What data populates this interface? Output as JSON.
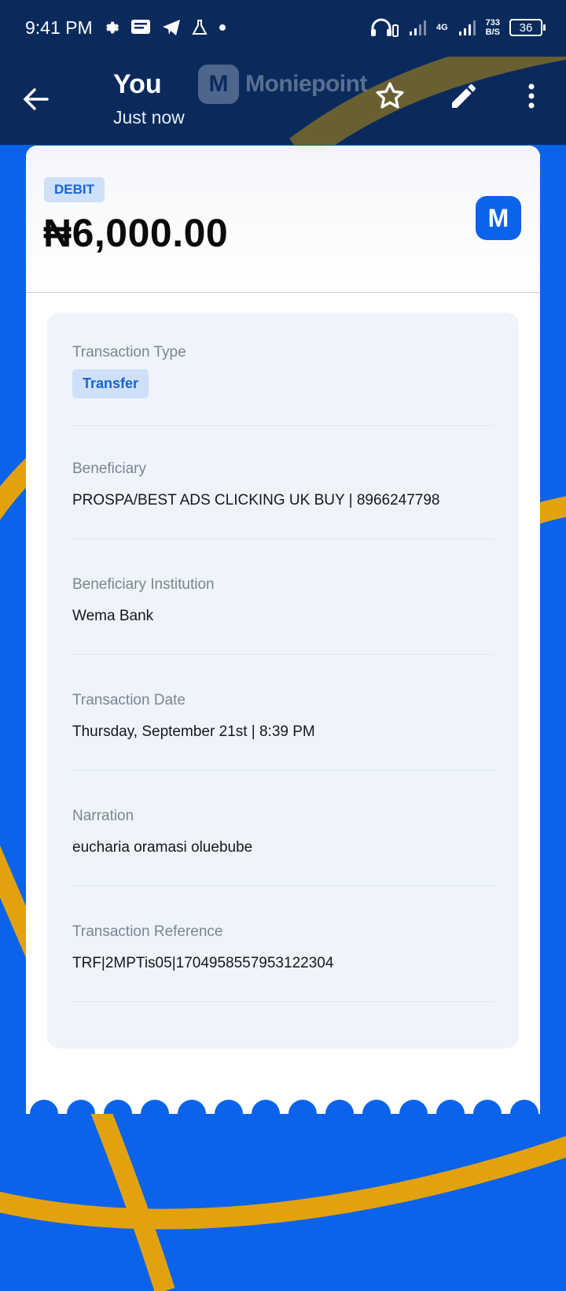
{
  "status_bar": {
    "time": "9:41 PM",
    "network": "4G",
    "speed_value": "733",
    "speed_unit": "B/S",
    "battery": "36"
  },
  "header": {
    "title": "You",
    "subtitle": "Just now",
    "brand_initial": "M",
    "brand_name": "Moniepoint"
  },
  "receipt": {
    "type_badge": "DEBIT",
    "amount": "₦6,000.00",
    "logo_initial": "M",
    "fields": [
      {
        "label": "Transaction Type",
        "value": "Transfer"
      },
      {
        "label": "Beneficiary",
        "value": "PROSPA/BEST ADS CLICKING UK BUY | 8966247798"
      },
      {
        "label": "Beneficiary Institution",
        "value": "Wema Bank"
      },
      {
        "label": "Transaction Date",
        "value": "Thursday, September 21st | 8:39 PM"
      },
      {
        "label": "Narration",
        "value": "eucharia oramasi oluebube"
      },
      {
        "label": "Transaction Reference",
        "value": "TRF|2MPTis05|1704958557953122304"
      }
    ]
  },
  "colors": {
    "header_bg": "#0b2a5c",
    "background_blue": "#0a63ea",
    "accent_gold": "#e2a20f",
    "badge_text": "#1565d8"
  }
}
